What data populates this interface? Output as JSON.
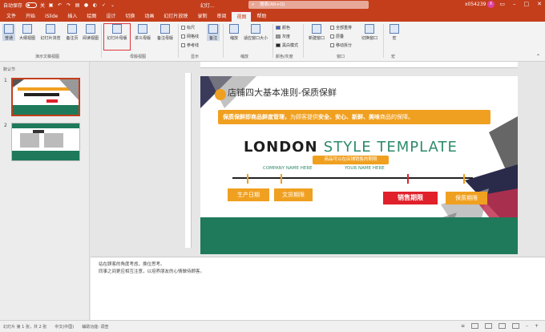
{
  "titlebar": {
    "autosave_label": "自动保存",
    "autosave_state": "关",
    "doc_title": "幻灯...",
    "search_placeholder": "搜索(Alt+Q)",
    "user": "x054239",
    "avatar_initial": "X"
  },
  "tabs": [
    "文件",
    "开始",
    "iSlide",
    "插入",
    "绘图",
    "设计",
    "切换",
    "动画",
    "幻灯片放映",
    "录制",
    "审阅",
    "视图",
    "帮助"
  ],
  "active_tab": "视图",
  "ribbon": {
    "normal": "普通",
    "outline_view": "大纲视图",
    "slide_sorter": "幻灯片浏览",
    "notes_page": "备注页",
    "reading_view": "阅读视图",
    "group_presentation_views": "演示文稿视图",
    "slide_master": "幻灯片母版",
    "handout_master": "讲义母版",
    "notes_master": "备注母版",
    "group_master_views": "母版视图",
    "ruler": "标尺",
    "gridlines": "网格线",
    "guides": "参考线",
    "group_show": "显示",
    "notes": "备注",
    "zoom": "缩放",
    "fit_to_window": "适应窗口大小",
    "group_zoom": "缩放",
    "color": "颜色",
    "grayscale": "灰度",
    "black_white": "黑白模式",
    "group_color": "颜色/灰度",
    "new_window": "新建窗口",
    "arrange_all": "全部重排",
    "cascade": "层叠",
    "move_split": "移动拆分",
    "switch_windows": "切换窗口",
    "group_window": "窗口",
    "macros": "宏",
    "group_macros": "宏"
  },
  "thumbnails": {
    "section": "默认节",
    "items": [
      {
        "num": "1",
        "caption": "LONDON STYLE TEMPLATE"
      },
      {
        "num": "2",
        "caption": ""
      }
    ]
  },
  "slide": {
    "title": "店铺四大基本准则-保质保鲜",
    "banner_bold1": "保质保鲜即商品鲜度管理，",
    "banner_rest1": "为顾客提供",
    "banner_bold2": "安全、安心、新鲜、美味",
    "banner_rest2": "商品的保障。",
    "heading_black": "LONDON",
    "heading_green": "STYLE TEMPLATE",
    "company_left": "COMPANY NAME HERE",
    "company_right": "YOUR NAME HERE",
    "tip": "商品可以在店铺销售的期限",
    "label_production": "生产日期",
    "label_shelf": "文货期限",
    "label_sales": "销售期限",
    "label_quality": "保质期限"
  },
  "notes": {
    "line1": "站在顾客的角度考虑，换位思考。",
    "line2": "同事之间更应相互注意，以培养朋友的心情做待顾客。"
  },
  "status": {
    "slide_info": "幻灯片 第 1 张，共 2 张",
    "language": "中文(中国)",
    "accessibility": "辅助功能: 调查"
  },
  "colors": {
    "brand": "#c43e1c",
    "orange": "#f0a020",
    "green": "#1e7a5a",
    "red": "#e0202a"
  }
}
